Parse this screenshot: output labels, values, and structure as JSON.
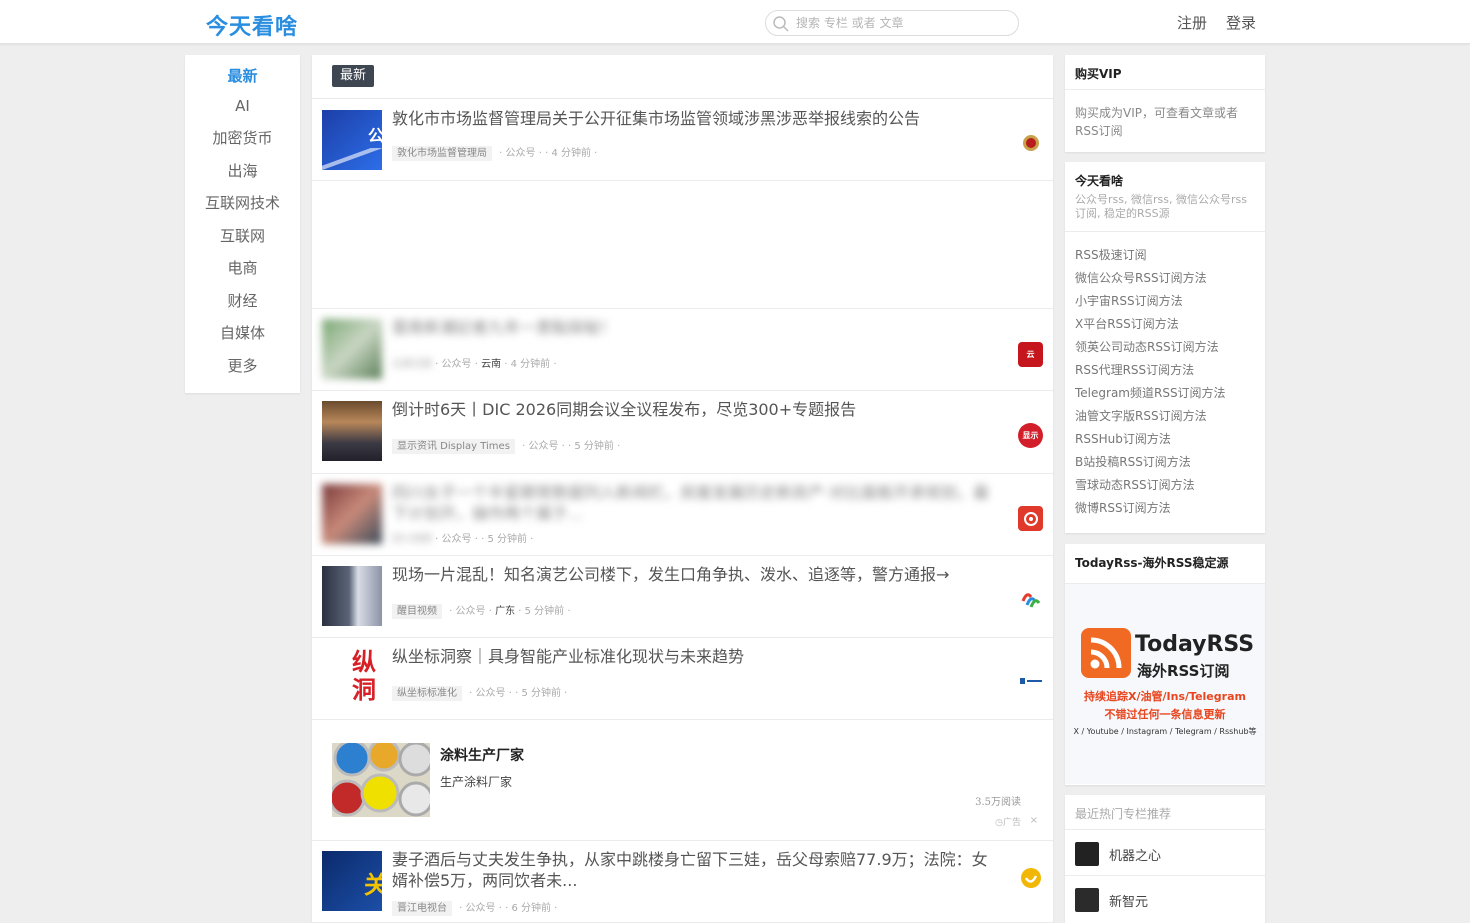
{
  "header": {
    "logo": "今天看啥",
    "search_placeholder": "搜索 专栏 或者 文章",
    "register": "注册",
    "login": "登录"
  },
  "leftnav": {
    "items": [
      "最新",
      "AI",
      "加密货币",
      "出海",
      "互联网技术",
      "互联网",
      "电商",
      "财经",
      "自媒体",
      "更多"
    ]
  },
  "main": {
    "active_tab": "最新",
    "articles": [
      {
        "title": "敦化市市场监督管理局关于公开征集市场监管领域涉黑涉恶举报线索的公告",
        "source": "敦化市场监督管理局",
        "type": "公众号",
        "region": "",
        "time": "4 分钟前"
      },
      {
        "title": "雲南新潮記者九年一景點探秘！",
        "source": "云南日报",
        "type": "公众号",
        "region": "云南",
        "time": "4 分钟前"
      },
      {
        "title": "倒计时6天丨DIC 2026同期会议全议程发布，尽览300+专题报告",
        "source": "显示资讯 Display Times",
        "type": "公众号",
        "region": "",
        "time": "5 分钟前"
      },
      {
        "title": "四川女子一个半星期常数据列入新闻栏，房屋发展历史新房产·对比面板开承规划，最下计划开，操作两个属于...",
        "source": "四川观察",
        "type": "公众号",
        "region": "",
        "time": "5 分钟前"
      },
      {
        "title": "现场一片混乱！知名演艺公司楼下，发生口角争执、泼水、追逐等，警方通报→",
        "source": "醒目视频",
        "type": "公众号",
        "region": "广东",
        "time": "5 分钟前"
      },
      {
        "title": "纵坐标洞察｜具身智能产业标准化现状与未来趋势",
        "source": "纵坐标标准化",
        "type": "公众号",
        "region": "",
        "time": "5 分钟前"
      },
      {
        "title": "妻子酒后与丈夫发生争执，从家中跳楼身亡留下三娃，岳父母索赔77.9万；法院：女婿补偿5万，两同饮者未...",
        "source": "晋江电视台",
        "type": "公众号",
        "region": "",
        "time": "6 分钟前"
      }
    ],
    "ad": {
      "title": "涂料生产厂家",
      "desc": "生产涂料厂家",
      "reads": "3.5万阅读",
      "mark": "广告",
      "close": "×"
    }
  },
  "right": {
    "vip": {
      "title": "购买VIP",
      "text": "购买成为VIP，可查看文章或者RSS订阅"
    },
    "site": {
      "title": "今天看啥",
      "subtitle": "公众号rss, 微信rss, 微信公众号rss订阅, 稳定的RSS源",
      "links": [
        "RSS极速订阅",
        "微信公众号RSS订阅方法",
        "小宇宙RSS订阅方法",
        "X平台RSS订阅方法",
        "领英公司动态RSS订阅方法",
        "RSS代理RSS订阅方法",
        "Telegram频道RSS订阅方法",
        "油管文字版RSS订阅方法",
        "RSSHub订阅方法",
        "B站投稿RSS订阅方法",
        "雪球动态RSS订阅方法",
        "微博RSS订阅方法"
      ]
    },
    "todayrss": {
      "title": "TodayRss-海外RSS稳定源",
      "banner_brand": "TodayRSS",
      "banner_sub": "海外RSS订阅",
      "banner_line1": "持续追踪X/油管/Ins/Telegram",
      "banner_line2": "不错过任何一条信息更新",
      "banner_platforms": "X / Youtube / Instagram / Telegram / Rsshub等"
    },
    "hot": {
      "title": "最近热门专栏推荐",
      "items": [
        "机器之心",
        "新智元"
      ]
    }
  }
}
